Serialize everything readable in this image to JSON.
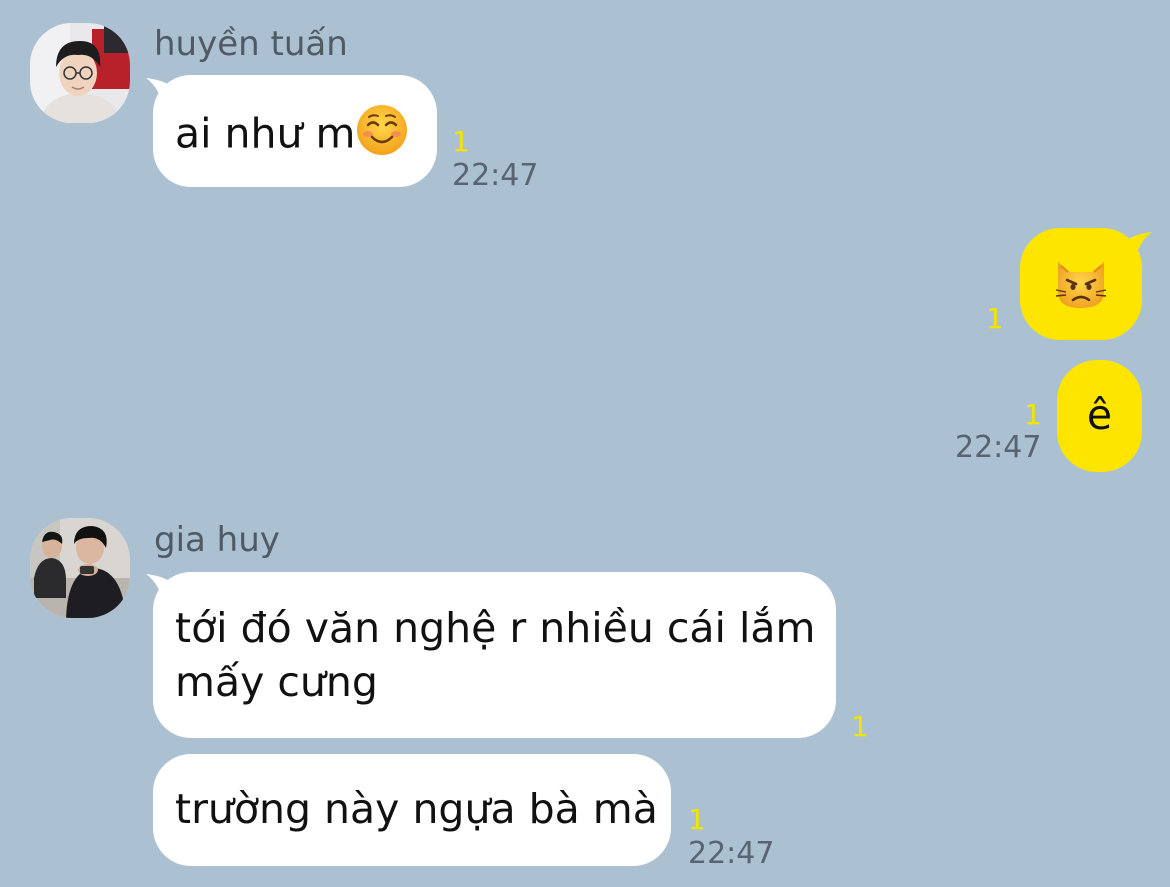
{
  "messages": [
    {
      "sender": "huyền tuấn",
      "avatar_icon": "user-avatar-photo",
      "text": "ai như m",
      "emoji_icon": "smiling-face-emoji",
      "read_count": "1",
      "time": "22:47"
    },
    {
      "sender": "me",
      "emoji_icon": "pouting-cat-emoji",
      "read_count": "1"
    },
    {
      "sender": "me",
      "text": "ê",
      "read_count": "1",
      "time": "22:47"
    },
    {
      "sender": "gia huy",
      "avatar_icon": "group-avatar-photo",
      "text": "tới đó văn nghệ r nhiều cái lắm\nmấy cưng",
      "read_count": "1"
    },
    {
      "sender": "gia huy",
      "text": "trường này ngựa bà mà",
      "read_count": "1",
      "time": "22:47"
    }
  ],
  "colors": {
    "background": "#abc1d2",
    "incoming_bubble": "#ffffff",
    "outgoing_bubble": "#fde500",
    "read_count": "#f3e400",
    "timestamp": "#586471"
  }
}
